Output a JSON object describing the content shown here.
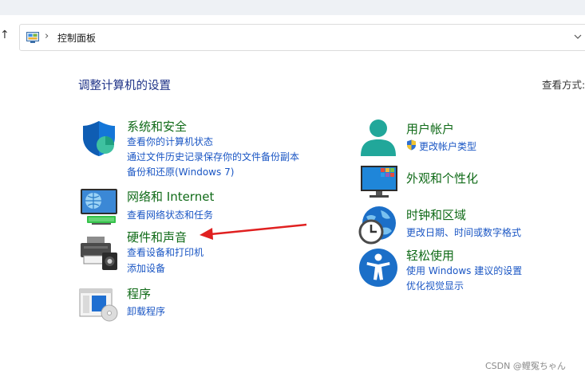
{
  "address": {
    "path": "控制面板"
  },
  "page_title": "调整计算机的设置",
  "view_by": "查看方式:",
  "left_categories": [
    {
      "title": "系统和安全",
      "links": [
        "查看你的计算机状态",
        "通过文件历史记录保存你的文件备份副本",
        "备份和还原(Windows 7)"
      ]
    },
    {
      "title": "网络和 Internet",
      "links": [
        "查看网络状态和任务"
      ]
    },
    {
      "title": "硬件和声音",
      "links": [
        "查看设备和打印机",
        "添加设备"
      ]
    },
    {
      "title": "程序",
      "links": [
        "卸载程序"
      ]
    }
  ],
  "right_categories": [
    {
      "title": "用户帐户",
      "links": [
        "更改帐户类型"
      ]
    },
    {
      "title": "外观和个性化",
      "links": []
    },
    {
      "title": "时钟和区域",
      "links": [
        "更改日期、时间或数字格式"
      ]
    },
    {
      "title": "轻松使用",
      "links": [
        "使用 Windows 建议的设置",
        "优化视觉显示"
      ]
    }
  ],
  "annotation": {
    "color": "#e02020"
  },
  "watermark": "CSDN @鲤冤ちゃん",
  "colors": {
    "category_title": "#0f6a17",
    "link": "#1a56c4",
    "page_title": "#1e3287"
  },
  "icons": [
    "up-arrow-icon",
    "control-panel-icon",
    "chevron-right-icon",
    "chevron-down-icon",
    "security-shield-icon",
    "network-icon",
    "printer-icon",
    "programs-icon",
    "user-icon",
    "uac-shield-icon",
    "display-icon",
    "clock-globe-icon",
    "accessibility-icon"
  ]
}
